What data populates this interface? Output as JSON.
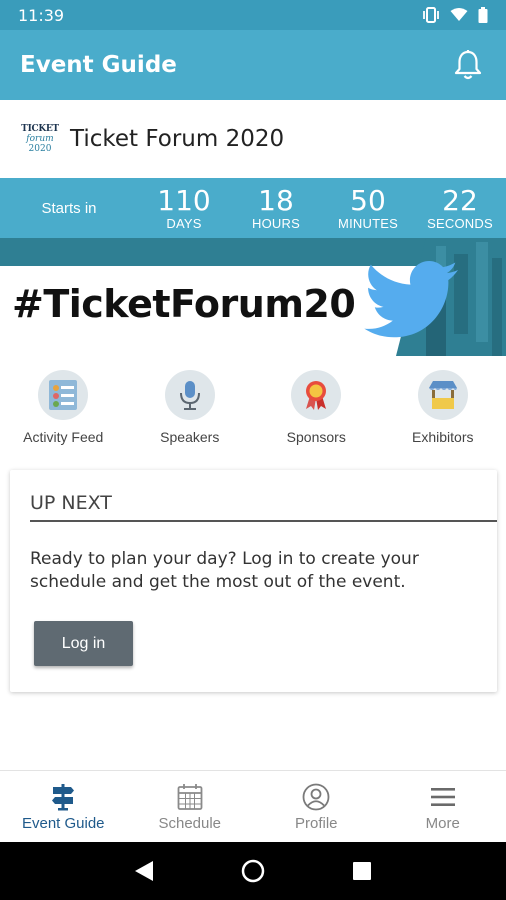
{
  "status_bar": {
    "time": "11:39"
  },
  "app_bar": {
    "title": "Event Guide"
  },
  "event": {
    "logo_line1": "TICKET",
    "logo_line2": "forum",
    "logo_line3": "2020",
    "name": "Ticket Forum 2020"
  },
  "countdown": {
    "label": "Starts in",
    "units": [
      {
        "value": "110",
        "label": "DAYS"
      },
      {
        "value": "18",
        "label": "HOURS"
      },
      {
        "value": "50",
        "label": "MINUTES"
      },
      {
        "value": "22",
        "label": "SECONDS"
      }
    ]
  },
  "banner": {
    "hashtag": "#TicketForum20"
  },
  "quick_links": [
    {
      "label": "Activity Feed",
      "icon": "activity-feed-icon"
    },
    {
      "label": "Speakers",
      "icon": "microphone-icon"
    },
    {
      "label": "Sponsors",
      "icon": "ribbon-icon"
    },
    {
      "label": "Exhibitors",
      "icon": "booth-icon"
    }
  ],
  "up_next": {
    "title": "UP NEXT",
    "text": "Ready to plan your day? Log in to create your schedule and get the most out of the event.",
    "button": "Log in"
  },
  "bottom_nav": [
    {
      "label": "Event Guide",
      "icon": "signpost-icon",
      "active": true
    },
    {
      "label": "Schedule",
      "icon": "calendar-icon",
      "active": false
    },
    {
      "label": "Profile",
      "icon": "profile-icon",
      "active": false
    },
    {
      "label": "More",
      "icon": "menu-icon",
      "active": false
    }
  ],
  "colors": {
    "primary": "#4aaccb",
    "status": "#3a9cbb",
    "active_nav": "#1f5a8b",
    "button": "#5f6a72",
    "twitter": "#55acee"
  }
}
